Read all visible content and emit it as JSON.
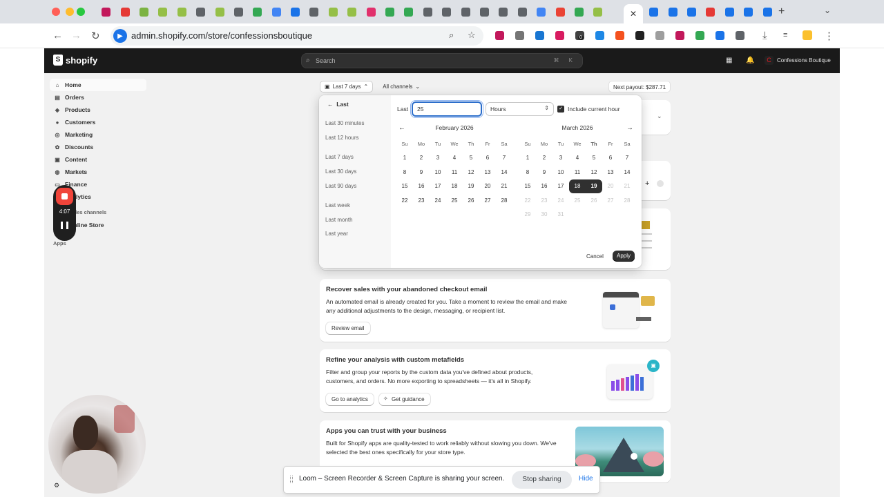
{
  "browser": {
    "tab_favicon_colors": [
      "#c2185b",
      "#e53935",
      "#7cb342",
      "#95bf47",
      "#95bf47",
      "#5f6368",
      "#95bf47",
      "#5f6368",
      "#34a853",
      "#4285f4",
      "#1a73e8",
      "#5f6368",
      "#95bf47",
      "#95bf47",
      "#e1306c",
      "#34a853",
      "#34a853",
      "#5f6368",
      "#5f6368",
      "#5f6368",
      "#5f6368",
      "#5f6368",
      "#5f6368",
      "#4285f4",
      "#ea4335",
      "#34a853",
      "#95bf47"
    ],
    "active_tab_close": "✕",
    "after_tab_colors": [
      "#1a73e8",
      "#1a73e8",
      "#1a73e8",
      "#e53935",
      "#1a73e8",
      "#1a73e8",
      "#1a73e8"
    ],
    "new_tab": "+",
    "tab_menu": "⌄",
    "url": "admin.shopify.com/store/confessionsboutique",
    "back": "←",
    "forward": "→",
    "reload": "↻",
    "zoom_icon": "⌕",
    "star_icon": "☆",
    "extension_colors": [
      "#c2185b",
      "#757575",
      "#1976d2",
      "#d81b60",
      "#424242",
      "#1e88e5",
      "#f4511e",
      "#212121",
      "#9e9e9e",
      "#c2185b",
      "#34a853",
      "#1a73e8",
      "#5f6368"
    ],
    "extension_badge": "0",
    "download_icon": "⤓",
    "menu_icon": "⋮"
  },
  "shopify": {
    "logo": "shopify",
    "search_placeholder": "Search",
    "search_shortcut": "⌘ K",
    "store_initial": "C",
    "store_name": "Confessions Boutique"
  },
  "sidebar": {
    "items": [
      {
        "label": "Home",
        "icon": "⌂"
      },
      {
        "label": "Orders",
        "icon": "▤"
      },
      {
        "label": "Products",
        "icon": "◈"
      },
      {
        "label": "Customers",
        "icon": "●"
      },
      {
        "label": "Marketing",
        "icon": "◎"
      },
      {
        "label": "Discounts",
        "icon": "✿"
      },
      {
        "label": "Content",
        "icon": "▣"
      },
      {
        "label": "Markets",
        "icon": "◍"
      },
      {
        "label": "Finance",
        "icon": "▭"
      },
      {
        "label": "Analytics",
        "icon": "▮"
      }
    ],
    "sales_channels": "Sales channels",
    "online_store": "Online Store",
    "apps": "Apps",
    "settings": "Settings"
  },
  "recorder": {
    "time": "4:07"
  },
  "dashboard": {
    "range_filter": "Last 7 days",
    "channels_filter": "All channels",
    "payout": "Next payout: $287.71",
    "cards": [
      {
        "title": "Recover sales with your abandoned checkout email",
        "body": "An automated email is already created for you. Take a moment to review the email and make any additional adjustments to the design, messaging, or recipient list.",
        "buttons": [
          "Review email"
        ]
      },
      {
        "title": "Refine your analysis with custom metafields",
        "body": "Filter and group your reports by the custom data you've defined about products, customers, and orders. No more exporting to spreadsheets — it's all in Shopify.",
        "buttons": [
          "Go to analytics",
          "Get guidance"
        ]
      },
      {
        "title": "Apps you can trust with your business",
        "body": "Built for Shopify apps are quality-tested to work reliably without slowing you down. We've selected the best ones specifically for your store type."
      }
    ]
  },
  "date_picker": {
    "back_label": "Last",
    "presets": [
      "Last 30 minutes",
      "Last 12 hours",
      "Last 7 days",
      "Last 30 days",
      "Last 90 days",
      "Last week",
      "Last month",
      "Last year"
    ],
    "last_label": "Last",
    "last_value": "25",
    "unit": "Hours",
    "include_current_hour": "Include current hour",
    "weekdays": [
      "Su",
      "Mo",
      "Tu",
      "We",
      "Th",
      "Fr",
      "Sa"
    ],
    "months": [
      {
        "title": "February 2026",
        "first_weekday": 0,
        "days": 28,
        "selected": [],
        "disabled_from": 99
      },
      {
        "title": "March 2026",
        "first_weekday": 0,
        "days": 31,
        "selected": [
          18,
          19
        ],
        "disabled_from": 20
      }
    ],
    "cancel": "Cancel",
    "apply": "Apply"
  },
  "loom": {
    "message": "Loom – Screen Recorder & Screen Capture is sharing your screen.",
    "stop": "Stop sharing",
    "hide": "Hide"
  }
}
